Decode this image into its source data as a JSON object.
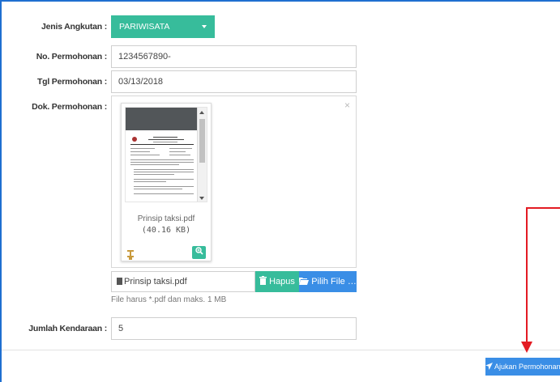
{
  "form": {
    "jenis_label": "Jenis Angkutan :",
    "jenis_value": "PARIWISATA",
    "nomor_label": "No. Permohonan :",
    "nomor_value": "1234567890-",
    "tgl_label": "Tgl Permohonan :",
    "tgl_value": "03/13/2018",
    "dok_label": "Dok. Permohonan :",
    "jumlah_label": "Jumlah Kendaraan :",
    "jumlah_value": "5"
  },
  "upload": {
    "close_glyph": "×",
    "file_name": "Prinsip taksi.pdf",
    "file_size": "(40.16 KB)",
    "caption_value": "Prinsip taksi.pdf",
    "hapus_label": "Hapus",
    "pilih_label": "Pilih File …",
    "hint": "File harus *.pdf dan maks. 1 MB"
  },
  "submit": {
    "label": "Ajukan Permohonan"
  },
  "colors": {
    "teal": "#37bc9b",
    "blue": "#3a8ee6",
    "annotation_red": "#e31b23"
  },
  "icons": [
    "caret-down-icon",
    "close-icon",
    "drag-handle-icon",
    "zoom-icon",
    "file-icon",
    "trash-icon",
    "folder-open-icon",
    "paper-plane-icon"
  ]
}
